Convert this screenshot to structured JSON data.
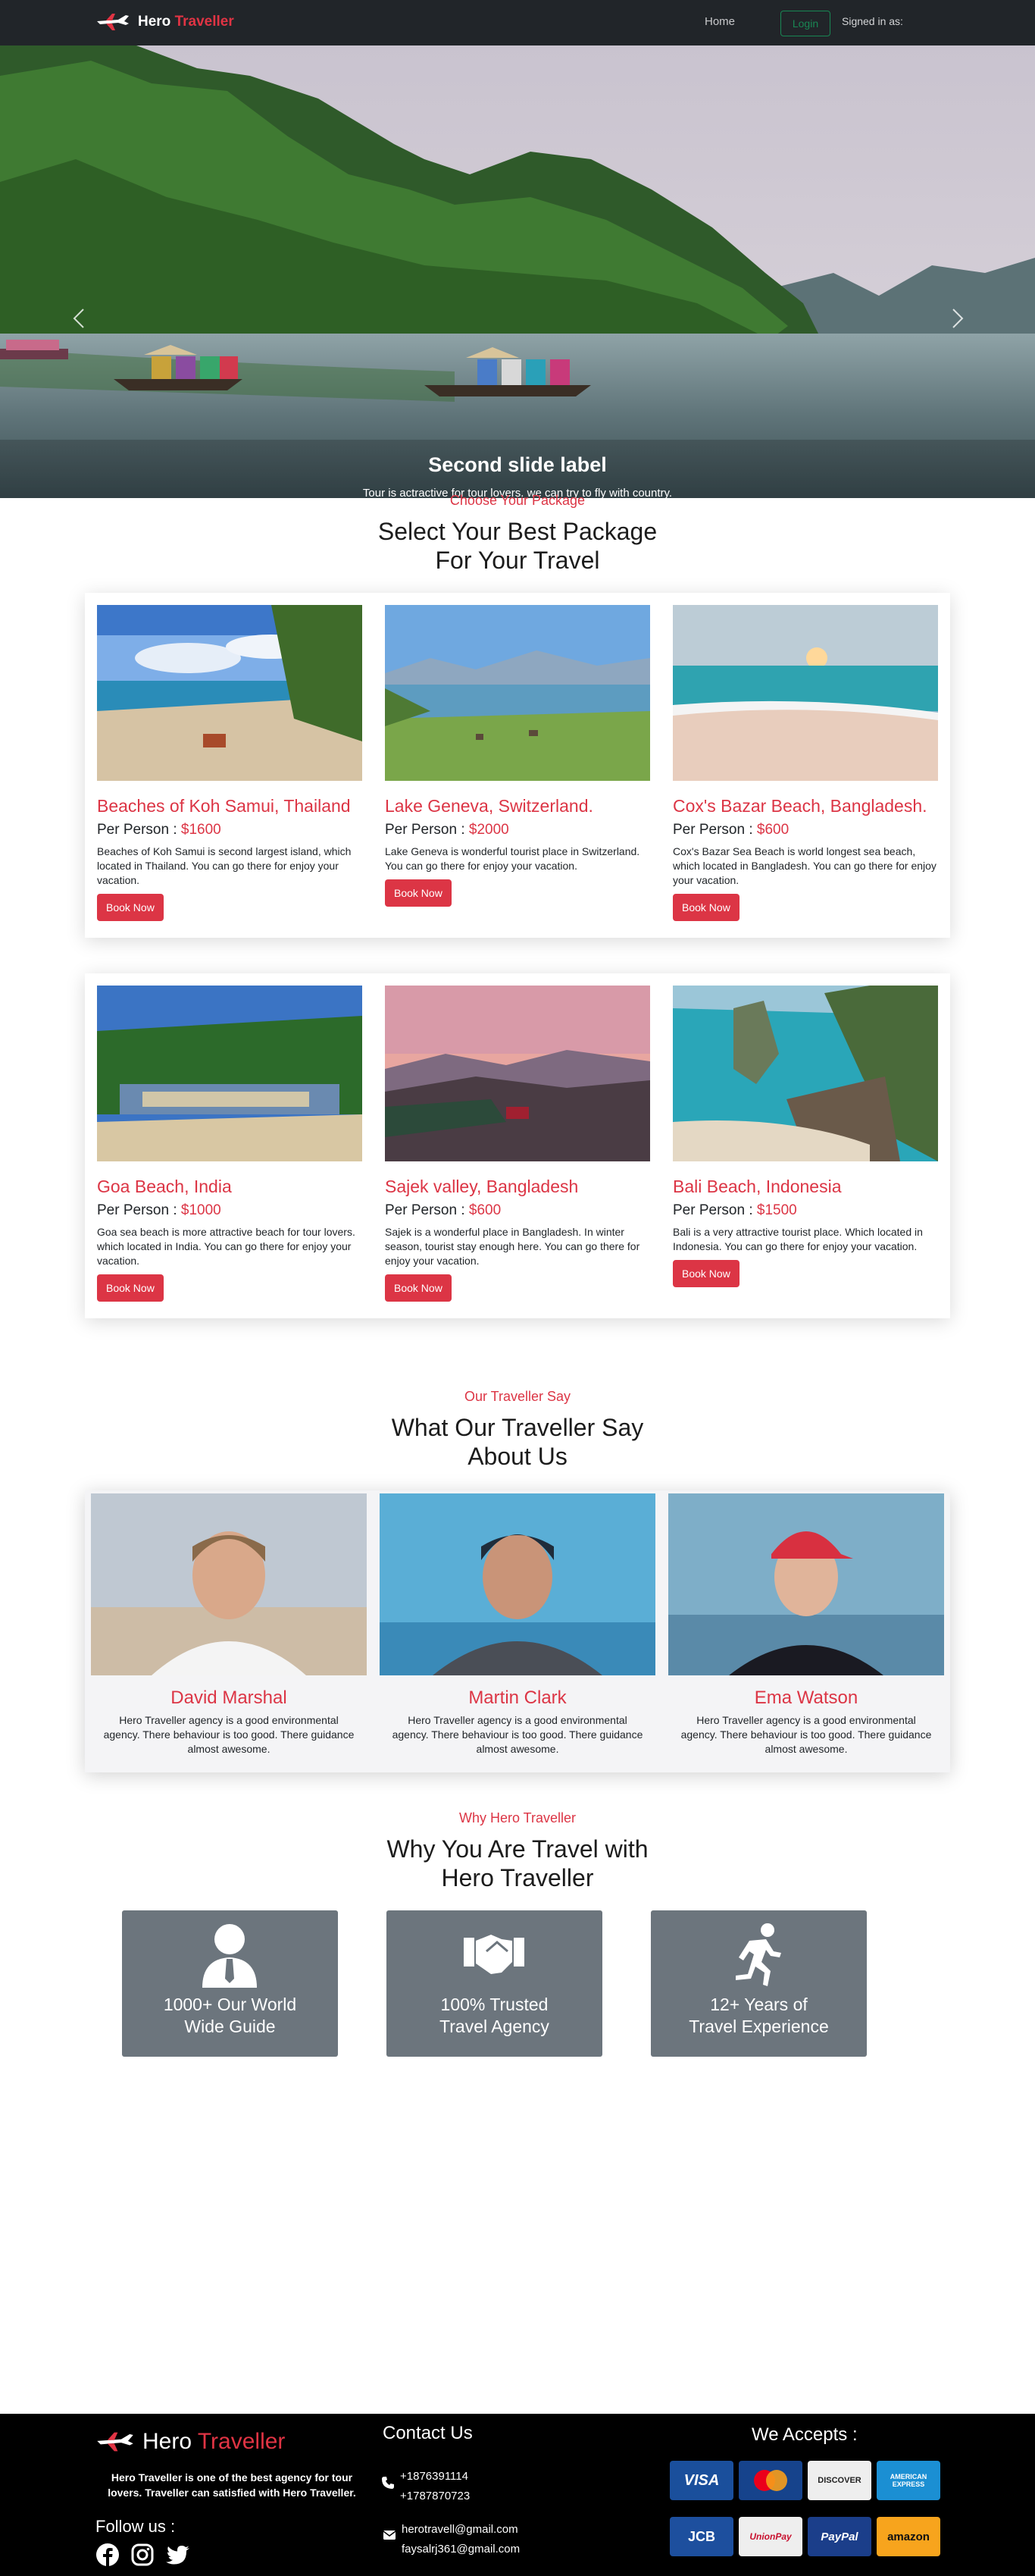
{
  "nav": {
    "brand_first": "Hero",
    "brand_second": "Traveller",
    "home": "Home",
    "login": "Login",
    "signed_in": "Signed in as:"
  },
  "carousel": {
    "caption_title": "Second slide label",
    "caption_text": "Tour is actractive for tour lovers. we can try to fly with country.",
    "slides": 3,
    "active_slide": 2
  },
  "packages_section": {
    "subtitle": "Choose Your Package",
    "title_line1": "Select Your Best Package",
    "title_line2": "For Your Travel",
    "price_label": "Per Person :",
    "book_label": "Book Now",
    "items": [
      {
        "name": "Beaches of Koh Samui, Thailand",
        "price": "$1600",
        "desc": "Beaches of Koh Samui is second largest island, which located in Thailand. You can go there for enjoy your vacation."
      },
      {
        "name": "Lake Geneva, Switzerland.",
        "price": "$2000",
        "desc": "Lake Geneva is wonderful tourist place in Switzerland. You can go there for enjoy your vacation."
      },
      {
        "name": "Cox's Bazar Beach, Bangladesh.",
        "price": "$600",
        "desc": "Cox's Bazar Sea Beach is world longest sea beach, which located in Bangladesh. You can go there for enjoy your vacation."
      },
      {
        "name": "Goa Beach, India",
        "price": "$1000",
        "desc": "Goa sea beach is more attractive beach for tour lovers. which located in India. You can go there for enjoy your vacation."
      },
      {
        "name": "Sajek valley, Bangladesh",
        "price": "$600",
        "desc": "Sajek is a wonderful place in Bangladesh. In winter season, tourist stay enough here. You can go there for enjoy your vacation."
      },
      {
        "name": "Bali Beach, Indonesia",
        "price": "$1500",
        "desc": "Bali is a very attractive tourist place. Which located in Indonesia. You can go there for enjoy your vacation."
      }
    ]
  },
  "testimonials_section": {
    "subtitle": "Our Traveller Say",
    "title_line1": "What Our Traveller Say",
    "title_line2": "About Us",
    "items": [
      {
        "name": "David Marshal",
        "text": "Hero Traveller agency is a good environmental agency. There behaviour is too good. There guidance almost awesome."
      },
      {
        "name": "Martin Clark",
        "text": "Hero Traveller agency is a good environmental agency. There behaviour is too good. There guidance almost awesome."
      },
      {
        "name": "Ema Watson",
        "text": "Hero Traveller agency is a good environmental agency. There behaviour is too good. There guidance almost awesome."
      }
    ]
  },
  "why_section": {
    "subtitle": "Why Hero Traveller",
    "title_line1": "Why You Are Travel with",
    "title_line2": "Hero Traveller",
    "items": [
      {
        "icon": "user-tie-icon",
        "line1": "1000+ Our World",
        "line2": "Wide Guide"
      },
      {
        "icon": "handshake-icon",
        "line1": "100% Trusted",
        "line2": "Travel Agency"
      },
      {
        "icon": "running-icon",
        "line1": "12+ Years of",
        "line2": "Travel Experience"
      }
    ]
  },
  "footer": {
    "brand_first": "Hero",
    "brand_second": "Traveller",
    "about": "Hero Traveller is one of the best agency for tour lovers. Traveller can satisfied with Hero Traveller.",
    "follow": "Follow us :",
    "contact_title": "Contact Us",
    "phone1": "+1876391114",
    "phone2": "+1787870723",
    "email1": "herotravell@gmail.com",
    "email2": "faysalrj361@gmail.com",
    "accept_title": "We Accepts :",
    "payments": [
      "VISA",
      "MasterCard",
      "DISCOVER",
      "AMERICAN EXPRESS",
      "JCB",
      "UnionPay",
      "PayPal",
      "amazon"
    ]
  },
  "colors": {
    "accent": "#dc3545",
    "navbar": "#212529",
    "login_green": "#198754",
    "why_box": "#6c757d",
    "footer": "#000000"
  }
}
